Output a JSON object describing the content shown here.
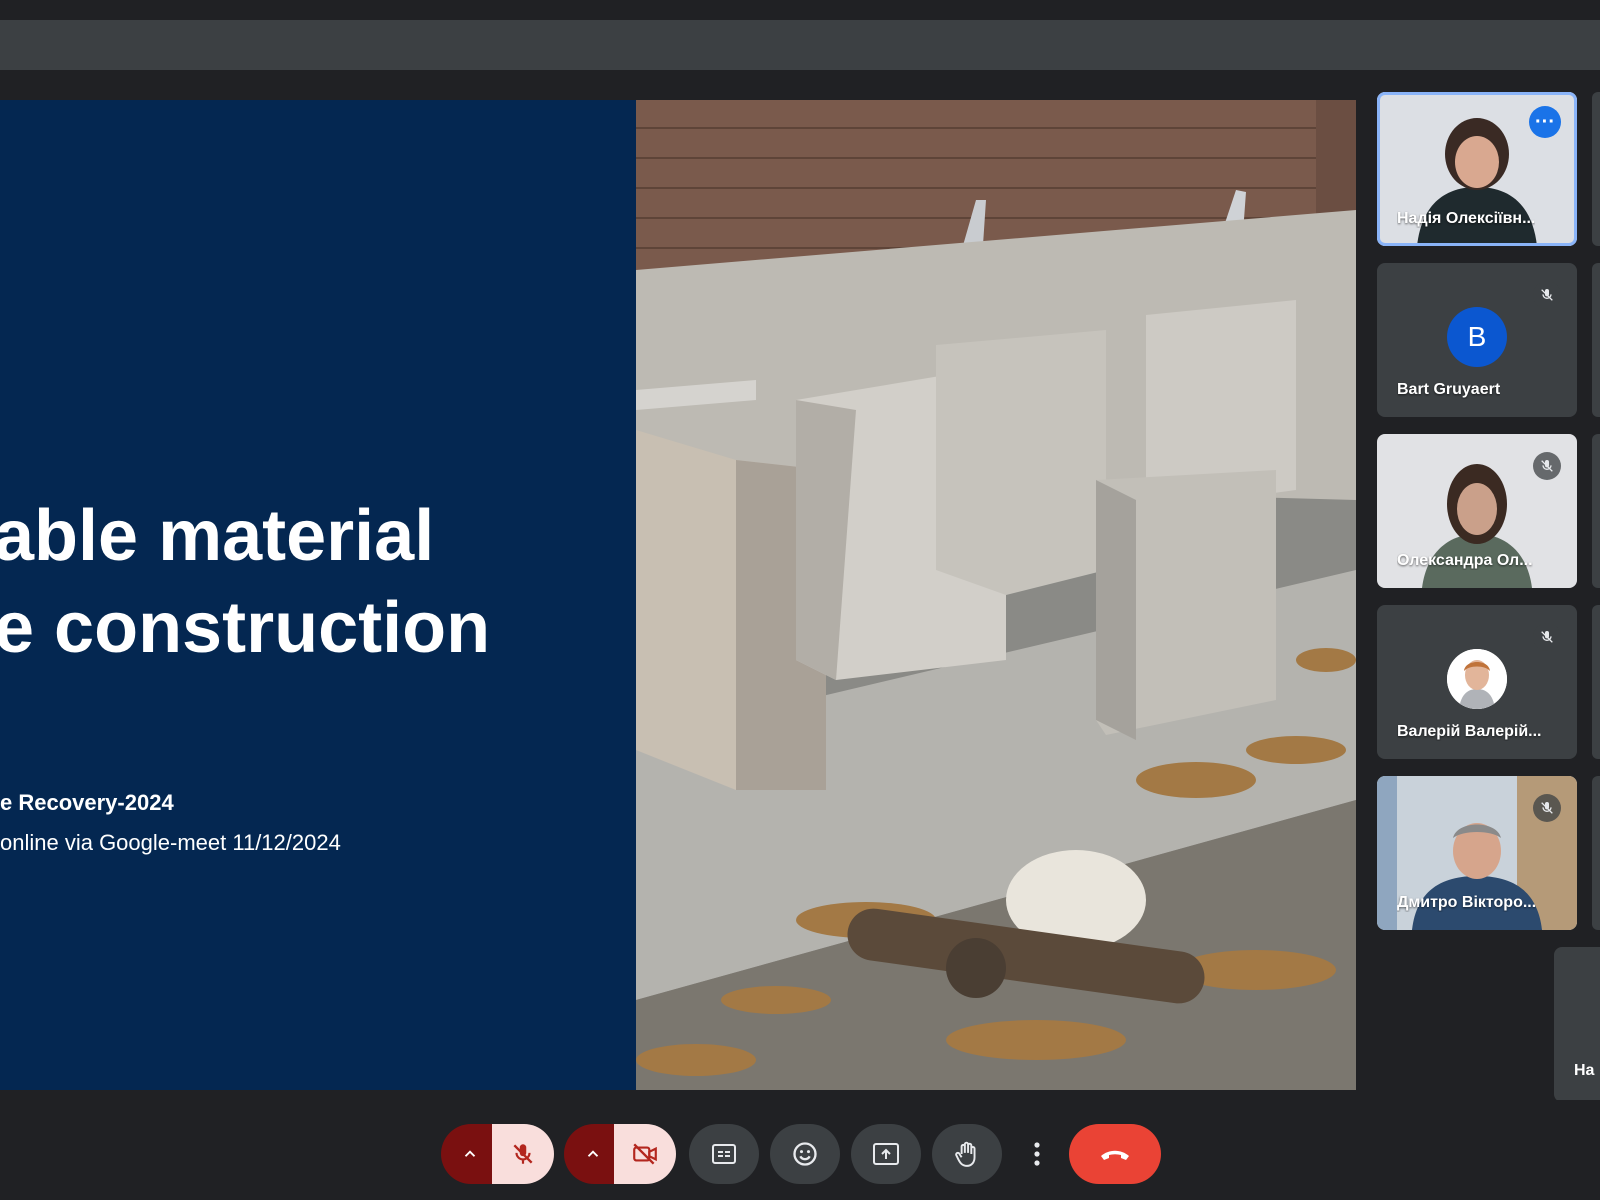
{
  "slide": {
    "title_line1": "able material",
    "title_line2": "e construction",
    "subtitle_line1": "e Recovery-2024",
    "subtitle_line2": " online via Google-meet 11/12/2024",
    "bg_color": "#042751"
  },
  "participants": [
    {
      "name": "Надія Олексіївн...",
      "video": true,
      "active_speaker": true,
      "more_options": true
    },
    {
      "name": "Bart Gruyaert",
      "video": false,
      "initial": "B",
      "mic_off": true
    },
    {
      "name": "Олександра Ол...",
      "video": true,
      "mic_off": true
    },
    {
      "name": "Валерій Валерій...",
      "video": false,
      "avatar_photo": true,
      "mic_off": true
    },
    {
      "name": "Дмитро Вікторо...",
      "video": true,
      "mic_off": true
    }
  ],
  "partial_participant": {
    "name": "На"
  },
  "controls": {
    "items": [
      "mic-options-chevron",
      "microphone-off",
      "camera-options-chevron",
      "camera-off",
      "closed-captions",
      "emoji-reactions",
      "present-screen",
      "raise-hand",
      "more-options",
      "leave-call"
    ]
  },
  "colors": {
    "end_call": "#ea4335",
    "toggle_off_bg": "#f9dedc",
    "toggle_off_icon": "#b3261e",
    "active_outline": "#8ab4f8"
  }
}
